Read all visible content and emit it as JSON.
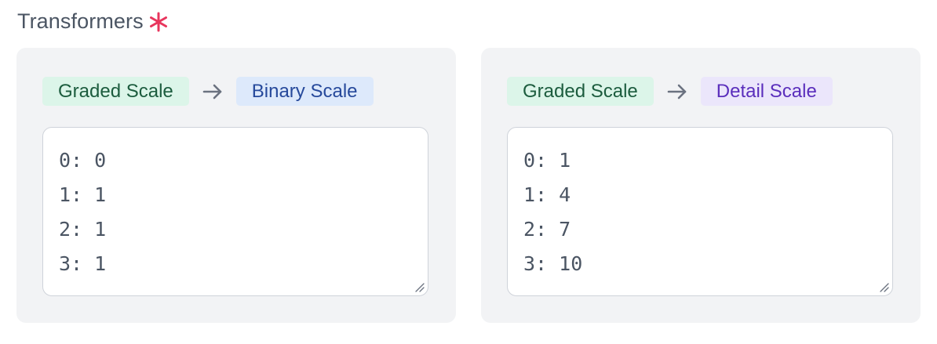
{
  "section": {
    "title": "Transformers"
  },
  "colors": {
    "required": "#e8365d",
    "text": "#4b5563"
  },
  "transformers": [
    {
      "from_label": "Graded Scale",
      "to_label": "Binary Scale",
      "mappings": [
        "0: 0",
        "1: 1",
        "2: 1",
        "3: 1"
      ]
    },
    {
      "from_label": "Graded Scale",
      "to_label": "Detail Scale",
      "mappings": [
        "0: 1",
        "1: 4",
        "2: 7",
        "3: 10"
      ]
    }
  ]
}
